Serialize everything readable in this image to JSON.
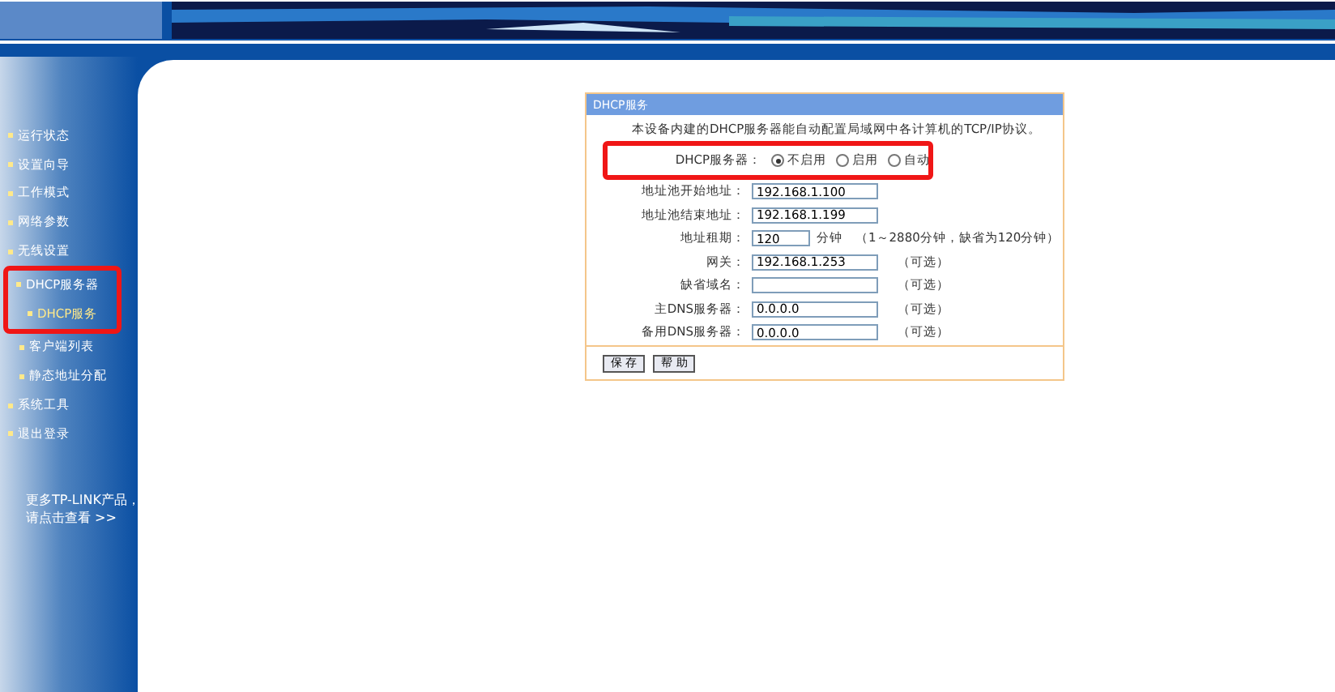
{
  "sidebar": {
    "items": [
      {
        "label": "运行状态",
        "selected": false
      },
      {
        "label": "设置向导",
        "selected": false
      },
      {
        "label": "工作模式",
        "selected": false
      },
      {
        "label": "网络参数",
        "selected": false
      },
      {
        "label": "无线设置",
        "selected": false
      },
      {
        "label": "DHCP服务器",
        "selected": false,
        "children": [
          {
            "label": "DHCP服务",
            "selected": true
          },
          {
            "label": "客户端列表",
            "selected": false
          },
          {
            "label": "静态地址分配",
            "selected": false
          }
        ]
      },
      {
        "label": "系统工具",
        "selected": false
      },
      {
        "label": "退出登录",
        "selected": false
      }
    ],
    "promo": [
      "更多TP-LINK产品，",
      "请点击查看 >>"
    ]
  },
  "panel": {
    "title": "DHCP服务",
    "description": "本设备内建的DHCP服务器能自动配置局域网中各计算机的TCP/IP协议。",
    "server": {
      "label": "DHCP服务器：",
      "options": [
        {
          "label": "不启用",
          "selected": true
        },
        {
          "label": "启用",
          "selected": false
        },
        {
          "label": "自动",
          "selected": false
        }
      ]
    },
    "fields": [
      {
        "label": "地址池开始地址：",
        "value": "192.168.1.100"
      },
      {
        "label": "地址池结束地址：",
        "value": "192.168.1.199"
      },
      {
        "label": "地址租期：",
        "value": "120",
        "short": true,
        "unit": "分钟",
        "note": "（1～2880分钟，缺省为120分钟）"
      },
      {
        "label": "网关：",
        "value": "192.168.1.253",
        "note": "（可选）"
      },
      {
        "label": "缺省域名：",
        "note": "（可选）"
      },
      {
        "label": "主DNS服务器：",
        "value": "0.0.0.0",
        "note": "（可选）"
      },
      {
        "label": "备用DNS服务器：",
        "value": "0.0.0.0",
        "note": "（可选）"
      }
    ],
    "buttons": [
      "保 存",
      "帮 助"
    ]
  }
}
